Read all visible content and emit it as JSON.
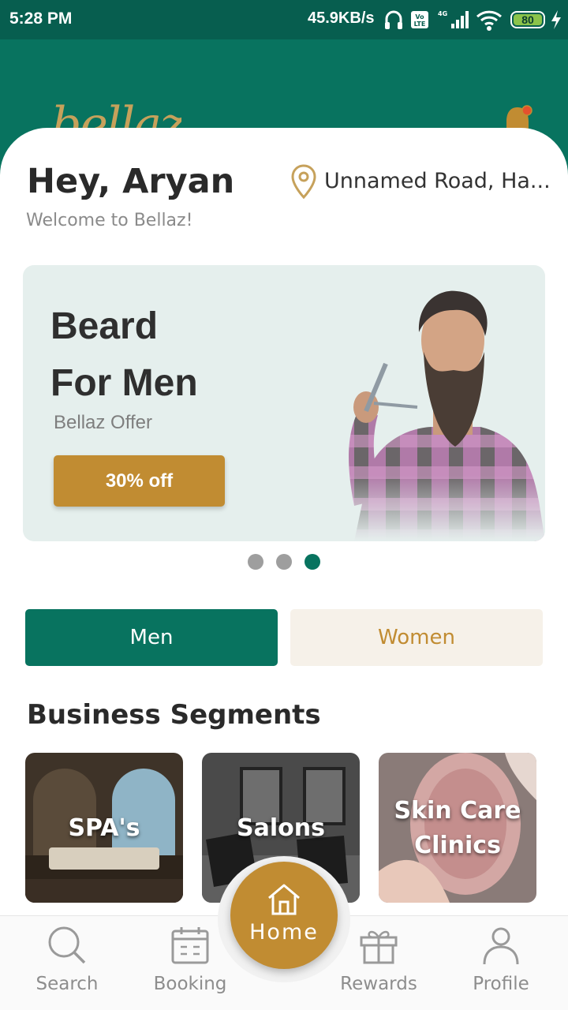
{
  "status_bar": {
    "time": "5:28 PM",
    "network_speed": "45.9KB/s",
    "battery_level": "80",
    "icons": [
      "headphones-icon",
      "volte-icon",
      "signal-4g-icon",
      "wifi-icon",
      "battery-icon",
      "charging-icon"
    ]
  },
  "header": {
    "logo_text": "bellaz",
    "notification_icon": "bell-icon",
    "notification_dot_color": "#e4512d"
  },
  "greeting": {
    "title": "Hey, Aryan",
    "subtitle": "Welcome to Bellaz!"
  },
  "location": {
    "icon": "map-pin-icon",
    "text": "Unnamed Road, Ha..."
  },
  "banner": {
    "title_line1": "Beard",
    "title_line2": "For Men",
    "subtitle": "Bellaz Offer",
    "button_label": "30% off",
    "carousel": {
      "total": 3,
      "active_index": 2
    }
  },
  "gender_tabs": [
    {
      "label": "Men",
      "selected": true
    },
    {
      "label": "Women",
      "selected": false
    }
  ],
  "segments": {
    "title": "Business Segments",
    "items": [
      {
        "label": "SPA's"
      },
      {
        "label": "Salons"
      },
      {
        "label": "Skin Care Clinics"
      }
    ]
  },
  "bottom_nav": {
    "items": [
      {
        "label": "Search",
        "icon": "search-icon"
      },
      {
        "label": "Booking",
        "icon": "calendar-icon"
      },
      {
        "label": "Home",
        "icon": "home-icon",
        "active": true
      },
      {
        "label": "Rewards",
        "icon": "gift-icon"
      },
      {
        "label": "Profile",
        "icon": "user-icon"
      }
    ]
  },
  "colors": {
    "primary": "#08735f",
    "accent": "#c18c32",
    "status_bar": "#075e4f"
  }
}
